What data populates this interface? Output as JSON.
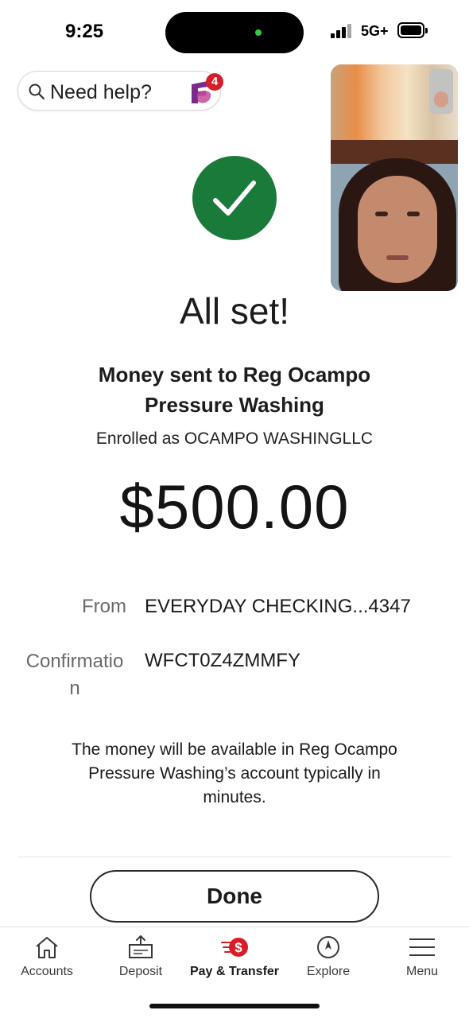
{
  "status_bar": {
    "time": "9:25",
    "network": "5G+"
  },
  "help": {
    "placeholder": "Need help?",
    "notification_count": "4"
  },
  "confirmation": {
    "headline": "All set!",
    "recipient": "Money sent to Reg Ocampo Pressure Washing",
    "enrolled_as": "Enrolled as OCAMPO WASHINGLLC",
    "amount": "$500.00",
    "from_label": "From",
    "from_value": "EVERYDAY CHECKING...4347",
    "confirmation_label": "Confirmation",
    "confirmation_value": "WFCT0Z4ZMMFY",
    "availability_note": "The money will be available in Reg Ocampo Pressure Washing’s account typically in minutes.",
    "done_label": "Done"
  },
  "tab_bar": {
    "tabs": [
      {
        "label": "Accounts",
        "icon": "home-icon"
      },
      {
        "label": "Deposit",
        "icon": "deposit-icon"
      },
      {
        "label": "Pay & Transfer",
        "icon": "pay-transfer-icon"
      },
      {
        "label": "Explore",
        "icon": "compass-icon"
      },
      {
        "label": "Menu",
        "icon": "hamburger-menu-icon"
      }
    ],
    "active": "Pay & Transfer"
  },
  "colors": {
    "success_green": "#1a7a3a",
    "brand_red": "#d71e28",
    "fargo_purple": "#7b2a8b"
  }
}
